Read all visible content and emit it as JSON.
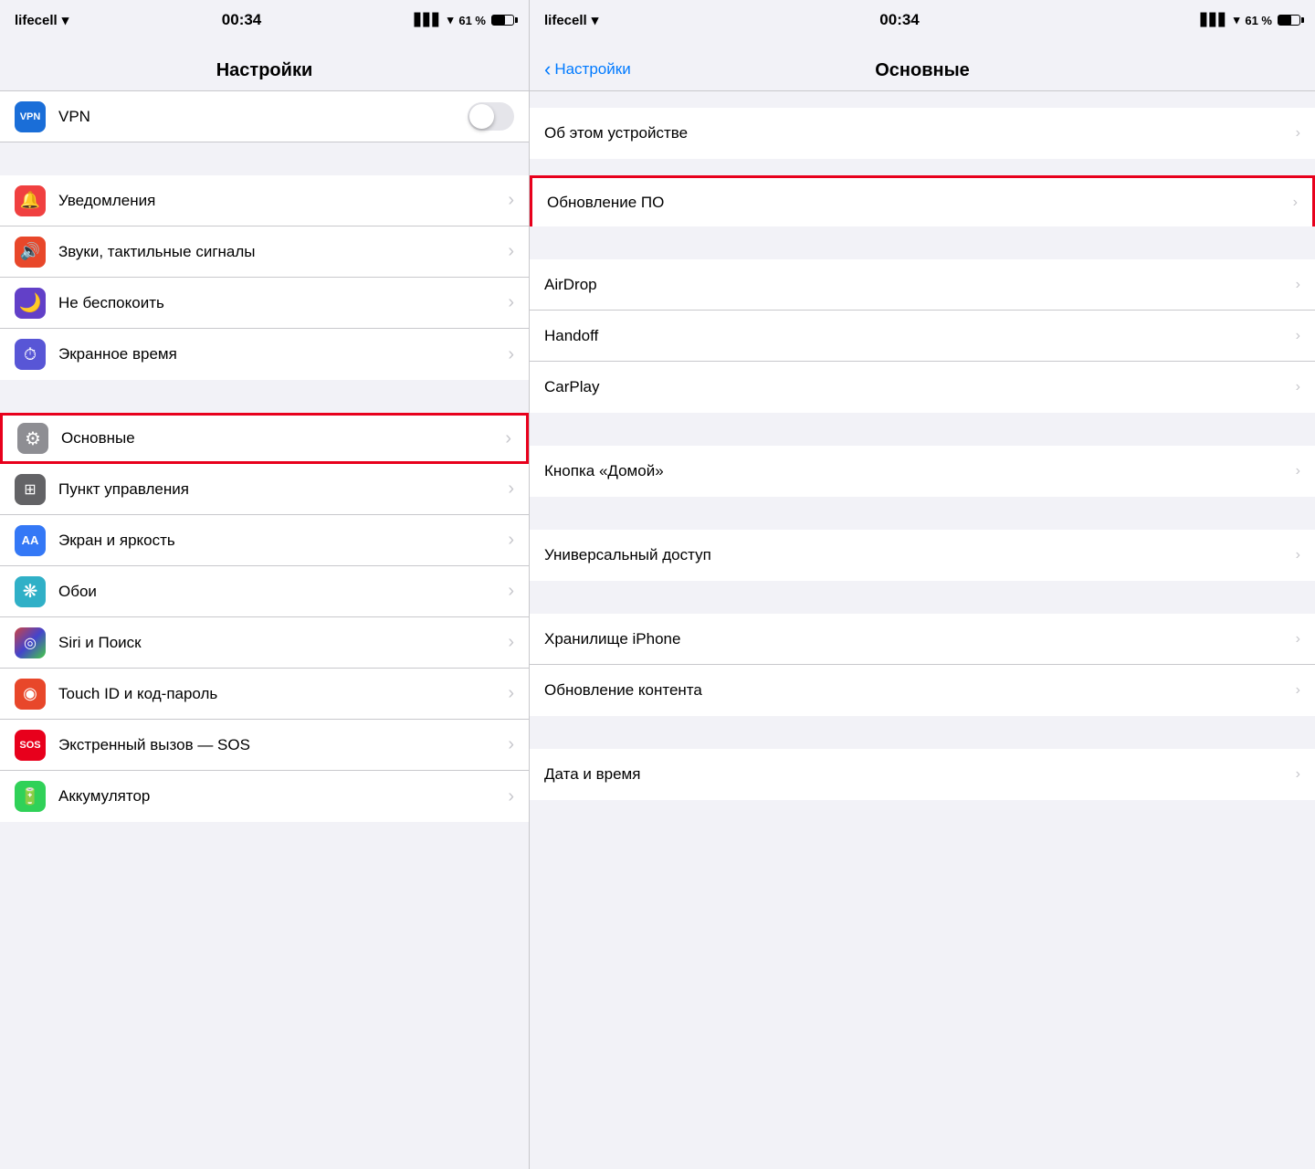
{
  "left": {
    "status": {
      "carrier": "lifecell",
      "wifi": true,
      "time": "00:34",
      "signal_bars": 4,
      "battery_percent": "61 %"
    },
    "title": "Настройки",
    "items": [
      {
        "id": "vpn",
        "icon_type": "vpn",
        "label": "VPN",
        "has_toggle": true,
        "has_chevron": false
      },
      {
        "id": "notifications",
        "icon_color": "icon-red",
        "icon_glyph": "🔔",
        "label": "Уведомления",
        "has_chevron": true,
        "section": 2
      },
      {
        "id": "sounds",
        "icon_color": "icon-orange-red",
        "icon_glyph": "🔊",
        "label": "Звуки, тактильные сигналы",
        "has_chevron": true
      },
      {
        "id": "dnd",
        "icon_color": "icon-purple",
        "icon_glyph": "🌙",
        "label": "Не беспокоить",
        "has_chevron": true
      },
      {
        "id": "screen-time",
        "icon_color": "icon-indigo",
        "icon_glyph": "⏱",
        "label": "Экранное время",
        "has_chevron": true
      },
      {
        "id": "general",
        "icon_color": "icon-gray",
        "icon_glyph": "⚙",
        "label": "Основные",
        "has_chevron": true,
        "highlighted": true,
        "section": 3
      },
      {
        "id": "control-center",
        "icon_color": "icon-gray2",
        "icon_glyph": "⊞",
        "label": "Пункт управления",
        "has_chevron": true
      },
      {
        "id": "display",
        "icon_color": "icon-blue-aa",
        "icon_glyph": "AA",
        "label": "Экран и яркость",
        "has_chevron": true
      },
      {
        "id": "wallpaper",
        "icon_color": "icon-teal",
        "icon_glyph": "❋",
        "label": "Обои",
        "has_chevron": true
      },
      {
        "id": "siri",
        "icon_color": "icon-blue-siri",
        "icon_glyph": "◎",
        "label": "Siri и Поиск",
        "has_chevron": true
      },
      {
        "id": "touch-id",
        "icon_color": "icon-red-touch",
        "icon_glyph": "◉",
        "label": "Touch ID и код-пароль",
        "has_chevron": true
      },
      {
        "id": "sos",
        "icon_color": "icon-sos",
        "icon_glyph": "SOS",
        "label": "Экстренный вызов — SOS",
        "has_chevron": true
      },
      {
        "id": "battery",
        "icon_color": "icon-green",
        "icon_glyph": "🔋",
        "label": "Аккумулятор",
        "has_chevron": true
      }
    ]
  },
  "right": {
    "status": {
      "carrier": "lifecell",
      "wifi": true,
      "time": "00:34",
      "battery_percent": "61 %"
    },
    "back_label": "Настройки",
    "title": "Основные",
    "sections": [
      {
        "items": [
          {
            "id": "about",
            "label": "Об этом устройстве",
            "has_chevron": true
          }
        ]
      },
      {
        "items": [
          {
            "id": "software-update",
            "label": "Обновление ПО",
            "has_chevron": true,
            "highlighted": true
          }
        ]
      },
      {
        "items": [
          {
            "id": "airdrop",
            "label": "AirDrop",
            "has_chevron": true
          },
          {
            "id": "handoff",
            "label": "Handoff",
            "has_chevron": true
          },
          {
            "id": "carplay",
            "label": "CarPlay",
            "has_chevron": true
          }
        ]
      },
      {
        "items": [
          {
            "id": "home-button",
            "label": "Кнопка «Домой»",
            "has_chevron": true
          }
        ]
      },
      {
        "items": [
          {
            "id": "accessibility",
            "label": "Универсальный доступ",
            "has_chevron": true
          }
        ]
      },
      {
        "items": [
          {
            "id": "storage",
            "label": "Хранилище iPhone",
            "has_chevron": true
          },
          {
            "id": "bg-refresh",
            "label": "Обновление контента",
            "has_chevron": true
          }
        ]
      },
      {
        "items": [
          {
            "id": "date-time",
            "label": "Дата и время",
            "has_chevron": true
          }
        ]
      }
    ]
  },
  "icons": {
    "chevron": "›",
    "back_chevron": "‹",
    "wifi": "wifi",
    "signal": "signal"
  }
}
